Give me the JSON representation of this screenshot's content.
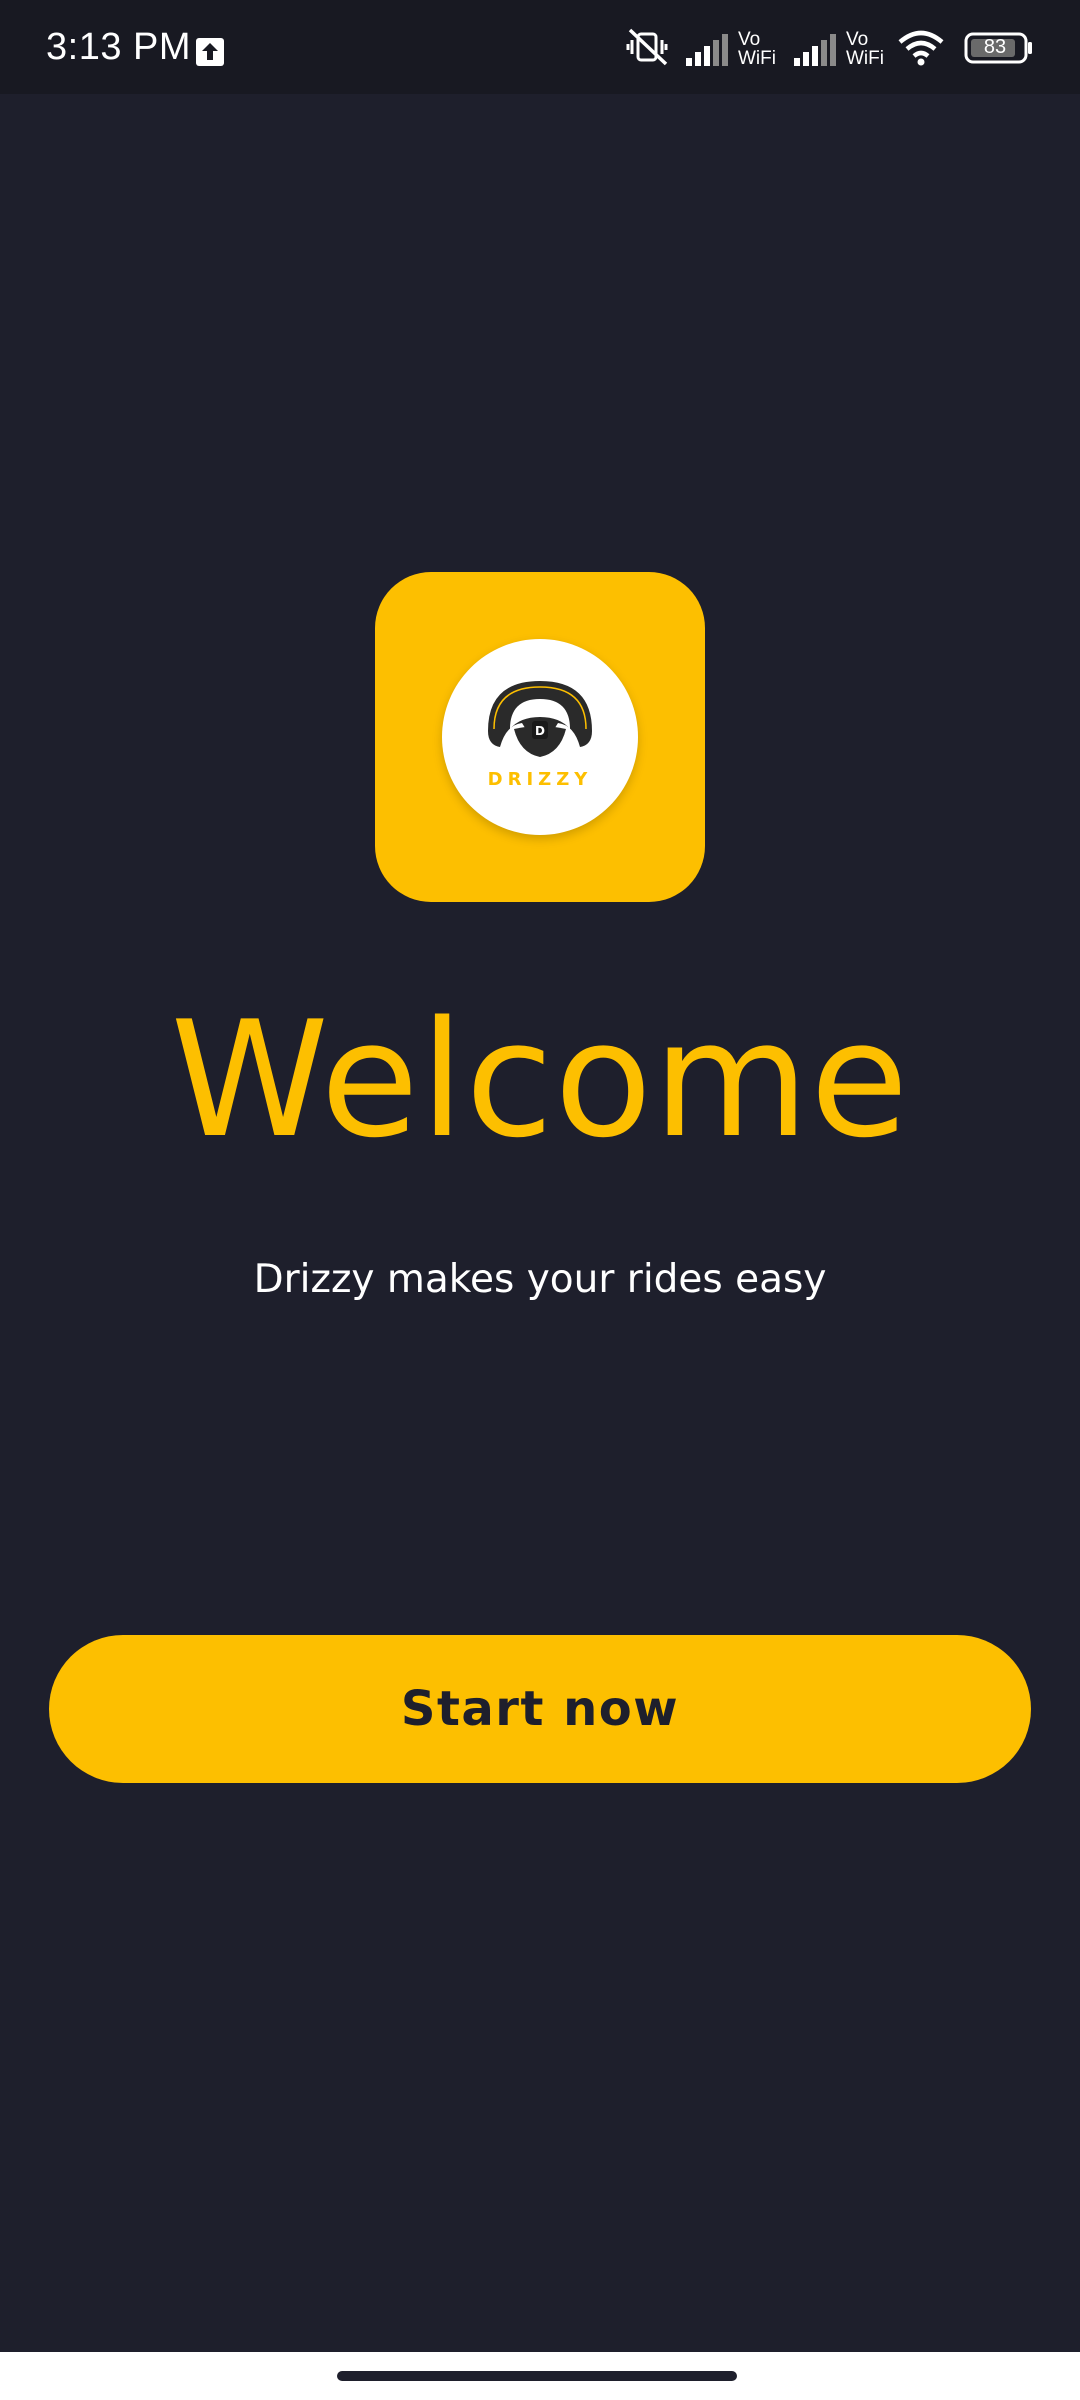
{
  "status_bar": {
    "time": "3:13 PM",
    "vowifi_1": "Vo\nWiFi",
    "vowifi_2": "Vo\nWiFi",
    "battery": "83",
    "icons": [
      "upload-icon",
      "mute-vibrate-icon",
      "signal-icon",
      "signal-icon",
      "wifi-icon",
      "battery-icon"
    ]
  },
  "logo": {
    "wheel_letter": "D",
    "wordmark": "DRIZZY"
  },
  "welcome": {
    "title": "Welcome",
    "subtitle": "Drizzy makes your rides easy"
  },
  "actions": {
    "start_label": "Start now"
  },
  "colors": {
    "background": "#1e1f2c",
    "accent": "#fdbf00",
    "text": "#ffffff"
  }
}
